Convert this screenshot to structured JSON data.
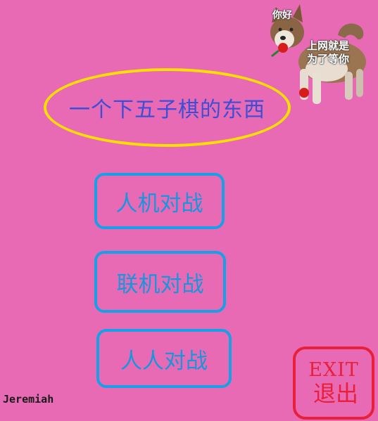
{
  "title": "一个下五子棋的东西",
  "menu": {
    "pve": "人机对战",
    "online": "联机对战",
    "pvp": "人人对战"
  },
  "exit": {
    "en": "EXIT",
    "cn": "退出"
  },
  "author": "Jeremiah",
  "sticker": {
    "hello": "你好",
    "caption_line1": "上网就是",
    "caption_line2": "为了等你"
  },
  "colors": {
    "background": "#e86ab4",
    "title_border": "#ffe000",
    "title_text": "#3b4fd6",
    "button_border": "#16a0e8",
    "exit": "#e8203a"
  }
}
